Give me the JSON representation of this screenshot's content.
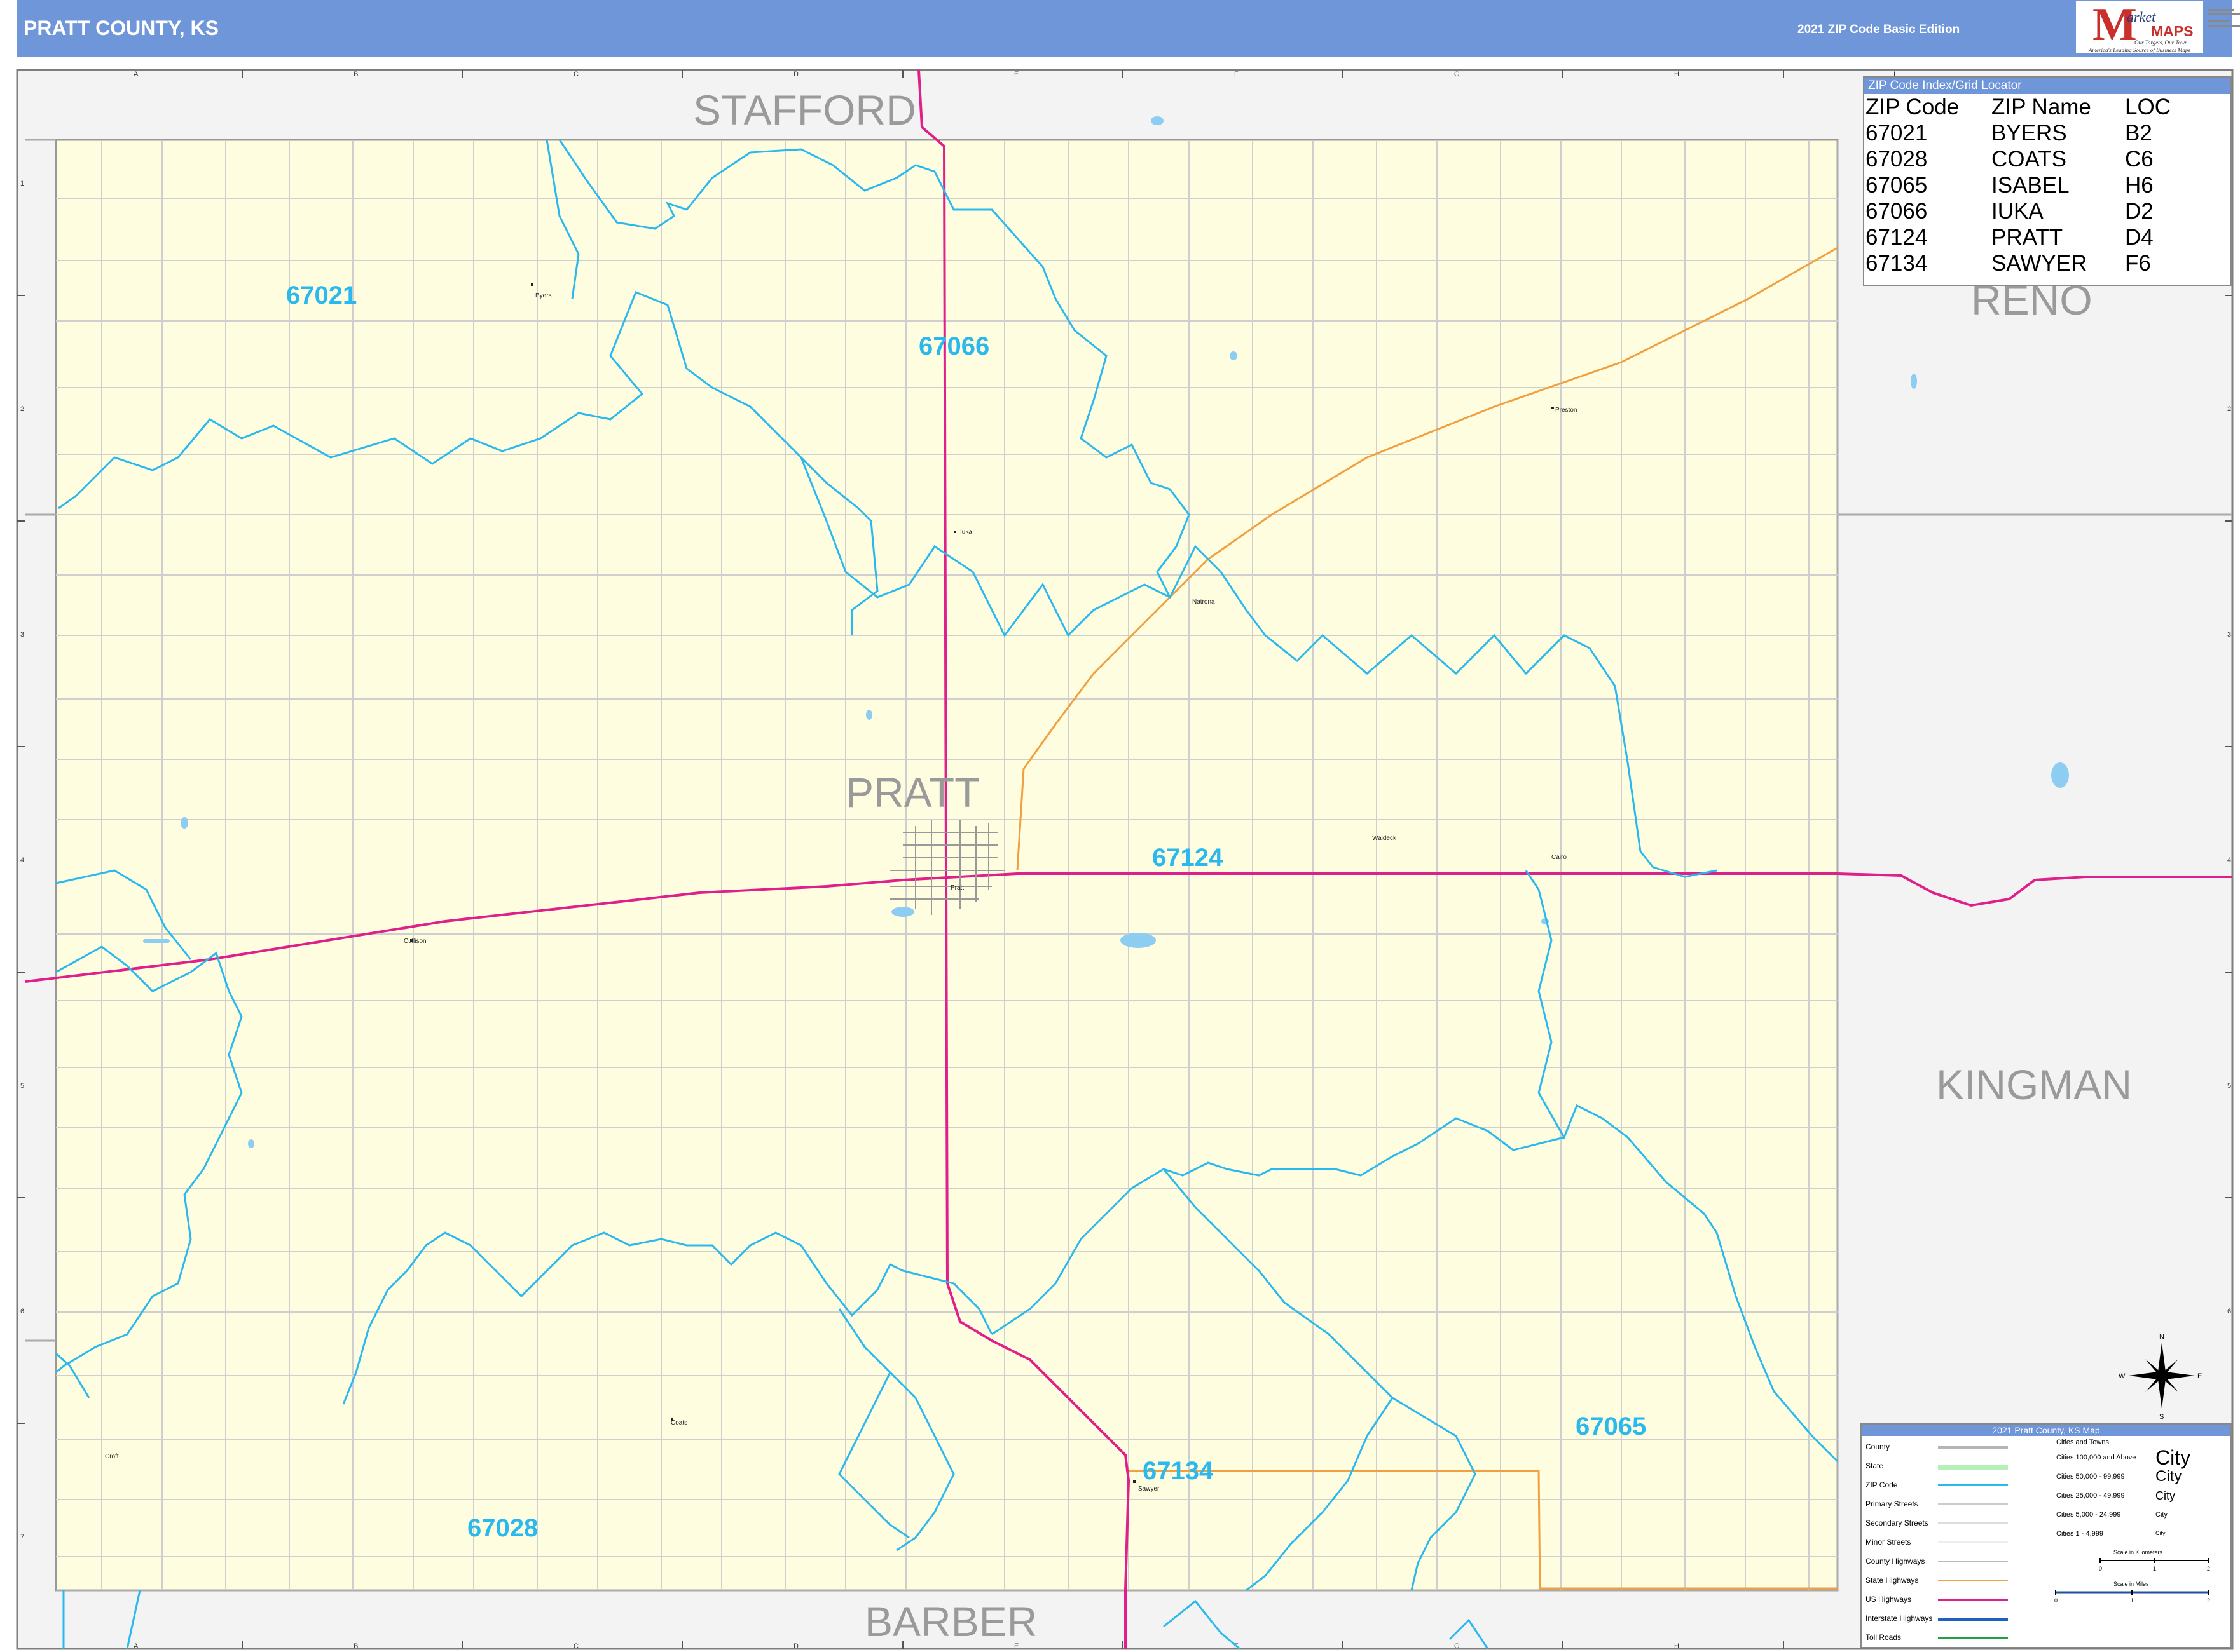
{
  "header": {
    "title": "PRATT COUNTY, KS",
    "edition": "2021 ZIP Code Basic Edition",
    "logo": {
      "initial": "M",
      "word1": "arket",
      "word2": "MAPS",
      "tagline1": "Our Targets, Our Town.",
      "tagline2": "America's Leading Source of Business Maps"
    }
  },
  "colors": {
    "header_bg": "#6f96d9",
    "county_fill": "#fffde0",
    "outside_fill": "#f3f3f3",
    "zip_boundary": "#29b9ee",
    "us_highway": "#e0208a",
    "state_highway": "#f0a040",
    "minor_street": "#c8c8c8",
    "water": "#8ecdf2"
  },
  "grid": {
    "columns": [
      "A",
      "B",
      "C",
      "D",
      "E",
      "F",
      "G",
      "H",
      "I"
    ],
    "rows": [
      "1",
      "2",
      "3",
      "4",
      "5",
      "6",
      "7"
    ]
  },
  "counties": {
    "center": "PRATT",
    "north": "STAFFORD",
    "northeast": "RENO",
    "east": "KINGMAN",
    "south": "BARBER"
  },
  "zip_areas": [
    "67021",
    "67066",
    "67124",
    "67065",
    "67134",
    "67028"
  ],
  "towns": [
    "Byers",
    "Iuka",
    "Preston",
    "Natrona",
    "Pratt",
    "Waldeck",
    "Cairo",
    "Cullison",
    "Coats",
    "Croft",
    "Sawyer"
  ],
  "zip_index": {
    "title": "ZIP Code Index/Grid Locator",
    "headers": [
      "ZIP Code",
      "ZIP Name",
      "LOC"
    ],
    "rows": [
      [
        "67021",
        "BYERS",
        "B2"
      ],
      [
        "67028",
        "COATS",
        "C6"
      ],
      [
        "67065",
        "ISABEL",
        "H6"
      ],
      [
        "67066",
        "IUKA",
        "D2"
      ],
      [
        "67124",
        "PRATT",
        "D4"
      ],
      [
        "67134",
        "SAWYER",
        "F6"
      ]
    ]
  },
  "legend": {
    "title": "2021 Pratt County, KS Map",
    "items": [
      "County",
      "State",
      "ZIP Code",
      "Primary Streets",
      "Secondary Streets",
      "Minor Streets",
      "County Highways",
      "State Highways",
      "US Highways",
      "Interstate Highways",
      "Toll Roads"
    ],
    "cities_title": "Cities and Towns",
    "cities": [
      {
        "range": "Cities 100,000 and Above",
        "sample": "City"
      },
      {
        "range": "Cities 50,000 - 99,999",
        "sample": "City"
      },
      {
        "range": "Cities 25,000 - 49,999",
        "sample": "City"
      },
      {
        "range": "Cities 5,000 - 24,999",
        "sample": "City"
      },
      {
        "range": "Cities 1 - 4,999",
        "sample": "City"
      }
    ],
    "scale_km_label": "Scale in Kilometers",
    "scale_mi_label": "Scale in Miles",
    "scale_km_ticks": [
      "0",
      "1",
      "2"
    ],
    "scale_mi_ticks": [
      "0",
      "1",
      "2"
    ]
  },
  "compass": {
    "n": "N",
    "s": "S",
    "e": "E",
    "w": "W"
  }
}
